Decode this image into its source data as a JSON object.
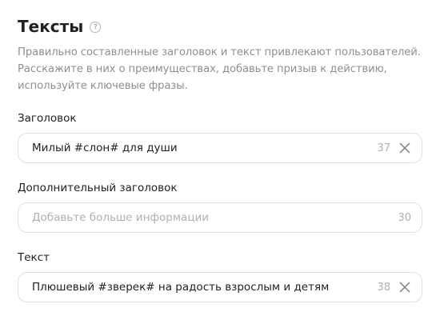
{
  "section": {
    "title": "Тексты",
    "help_icon": "question-circle-icon",
    "description": "Правильно составленные заголовок и текст привлекают пользователей. Расскажите в них о преимуществах, добавьте призыв к действию, используйте ключевые фразы."
  },
  "fields": {
    "headline": {
      "label": "Заголовок",
      "value": "Милый #слон# для души",
      "counter": "37",
      "clear_icon": "close-icon"
    },
    "subheadline": {
      "label": "Дополнительный заголовок",
      "value": "",
      "placeholder": "Добавьте больше информации",
      "counter": "30"
    },
    "text": {
      "label": "Текст",
      "value": "Плюшевый #зверек# на радость взрослым и детям",
      "counter": "38",
      "clear_icon": "close-icon"
    }
  },
  "colors": {
    "text": "#222222",
    "muted": "#8f8f8f",
    "placeholder": "#b0b0b0",
    "border": "#e1e1e1"
  }
}
